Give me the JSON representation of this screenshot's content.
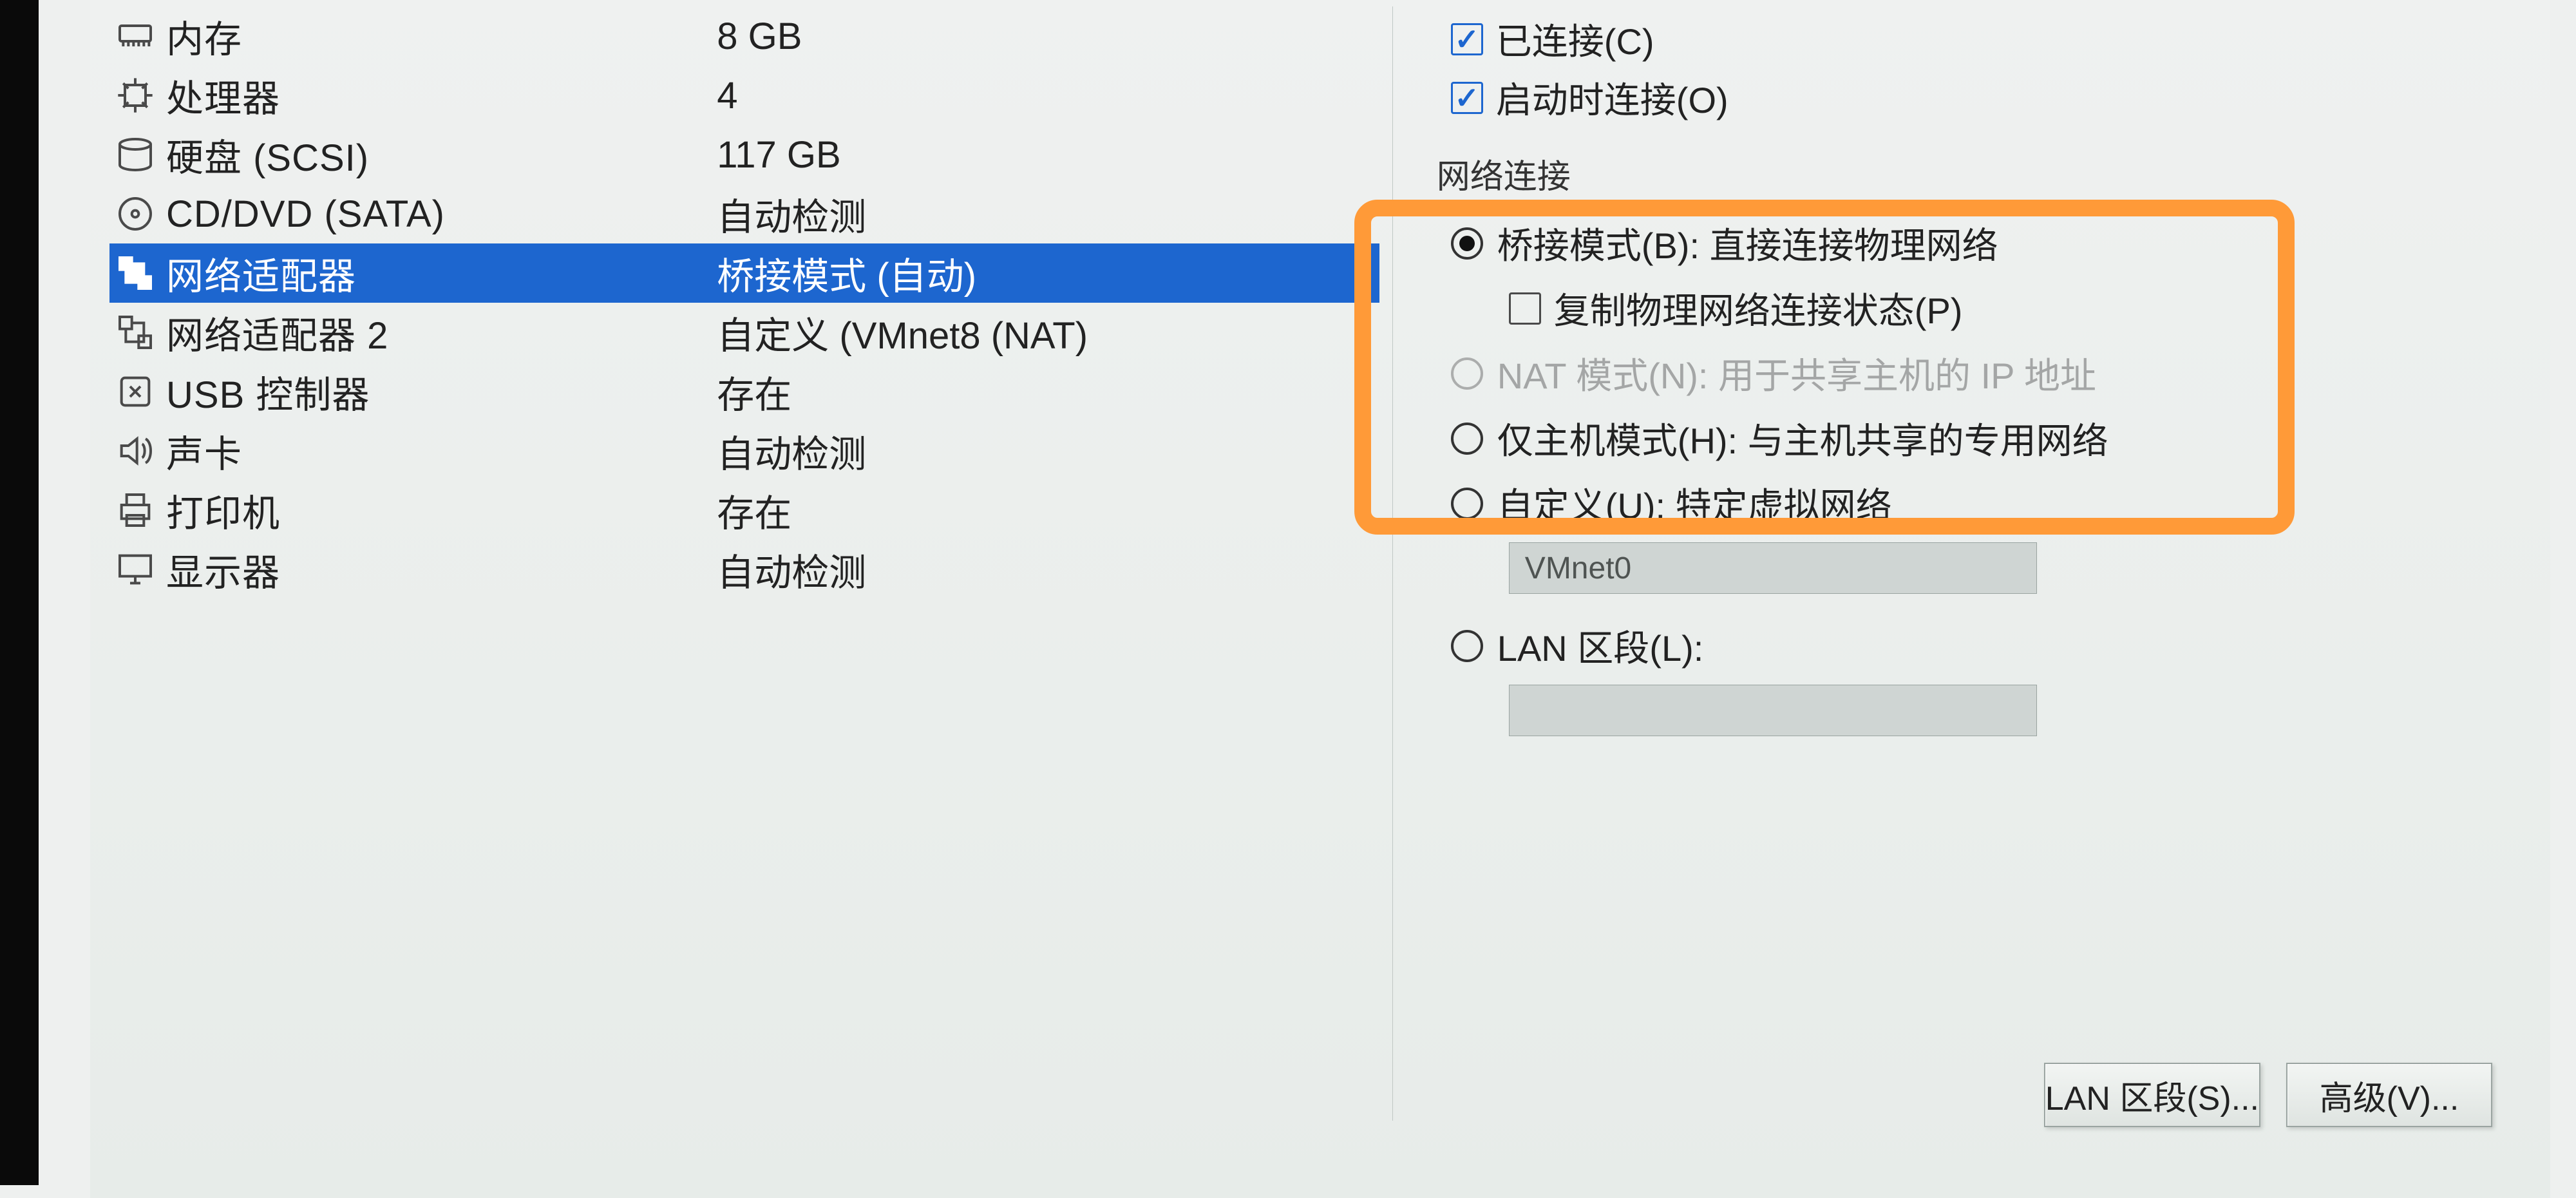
{
  "hardware_list": {
    "memory": {
      "label": "内存",
      "value": "8 GB"
    },
    "processor": {
      "label": "处理器",
      "value": "4"
    },
    "disk": {
      "label": "硬盘 (SCSI)",
      "value": "117 GB"
    },
    "cd": {
      "label": "CD/DVD (SATA)",
      "value": "自动检测"
    },
    "nic1": {
      "label": "网络适配器",
      "value": "桥接模式 (自动)"
    },
    "nic2": {
      "label": "网络适配器 2",
      "value": "自定义 (VMnet8 (NAT)"
    },
    "usb": {
      "label": "USB 控制器",
      "value": "存在"
    },
    "sound": {
      "label": "声卡",
      "value": "自动检测"
    },
    "printer": {
      "label": "打印机",
      "value": "存在"
    },
    "display": {
      "label": "显示器",
      "value": "自动检测"
    }
  },
  "device_state": {
    "connected": "已连接(C)",
    "connect_at_start": "启动时连接(O)"
  },
  "network": {
    "group_title": "网络连接",
    "bridged": "桥接模式(B): 直接连接物理网络",
    "replicate": "复制物理网络连接状态(P)",
    "nat": "NAT 模式(N): 用于共享主机的 IP 地址",
    "hostonly": "仅主机模式(H): 与主机共享的专用网络",
    "custom": "自定义(U): 特定虚拟网络",
    "custom_value": "VMnet0",
    "lan_segment": "LAN 区段(L):",
    "lan_segment_value": ""
  },
  "buttons": {
    "lan_segments": "LAN 区段(S)...",
    "advanced": "高级(V)..."
  }
}
